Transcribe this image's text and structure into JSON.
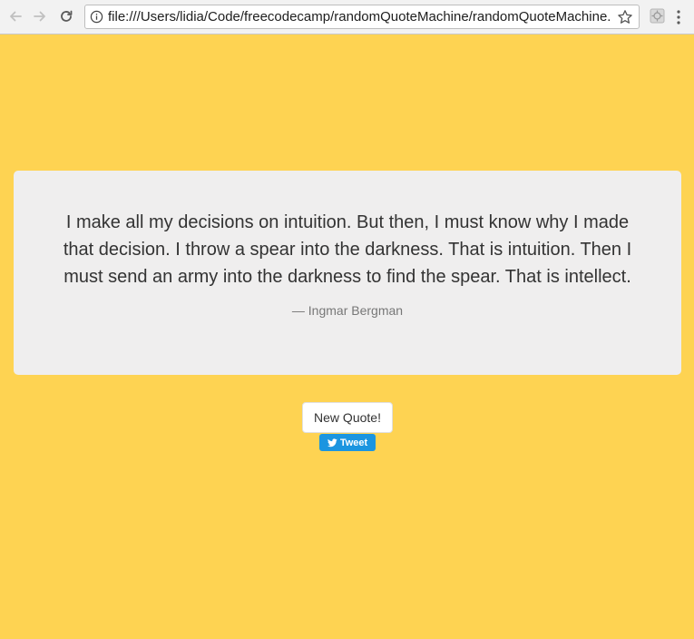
{
  "browser": {
    "url": "file:///Users/lidia/Code/freecodecamp/randomQuoteMachine/randomQuoteMachine...."
  },
  "quote": {
    "text": "I make all my decisions on intuition. But then, I must know why I made that decision. I throw a spear into the darkness. That is intuition. Then I must send an army into the darkness to find the spear. That is intellect.",
    "author": "— Ingmar Bergman"
  },
  "buttons": {
    "new_quote_label": "New Quote!",
    "tweet_label": "Tweet"
  },
  "colors": {
    "page_background": "#FED352",
    "card_background": "#EFEEEE",
    "tweet_button": "#1B95E0"
  },
  "icons": {
    "back": "arrow-left",
    "forward": "arrow-right",
    "reload": "reload",
    "info": "info-circle",
    "bookmark": "star-outline",
    "extension": "extension-puzzle",
    "menu": "vertical-dots",
    "twitter": "twitter-bird"
  }
}
